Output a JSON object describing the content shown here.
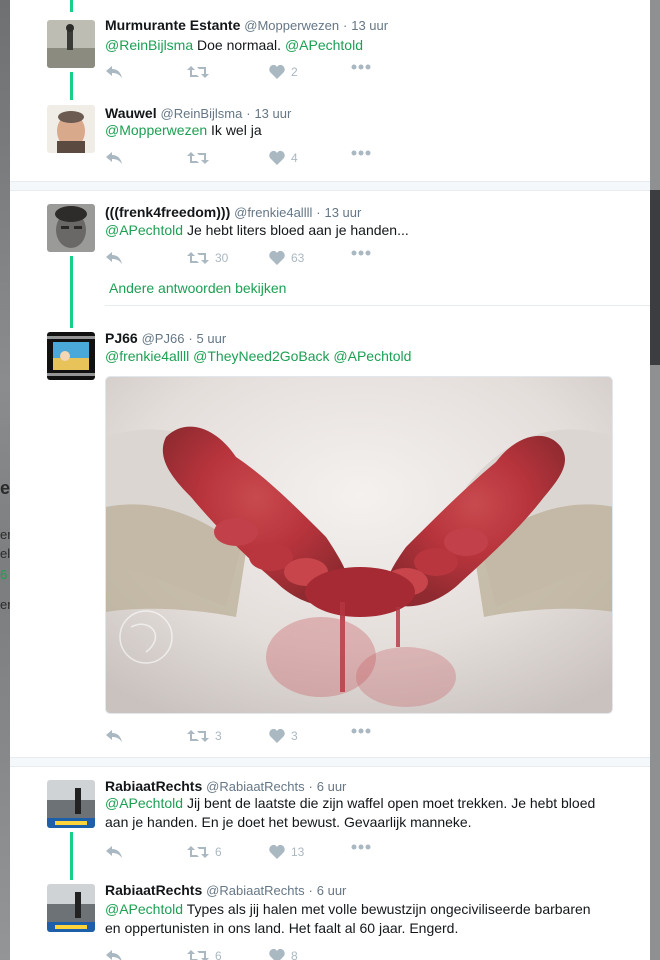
{
  "background": {
    "left_fragments": [
      "er",
      "er",
      "el",
      "6",
      "erc"
    ]
  },
  "tweets": [
    {
      "name": "Murmurante Estante",
      "handle": "@Mopperwezen",
      "time": "13 uur",
      "mention": "@ReinBijlsma",
      "text": "Doe normaal.",
      "mention2": "@APechtold",
      "retweets": "",
      "likes": "2"
    },
    {
      "name": "Wauwel",
      "handle": "@ReinBijlsma",
      "time": "13 uur",
      "mention": "@Mopperwezen",
      "text": "Ik wel ja",
      "retweets": "",
      "likes": "4"
    },
    {
      "name": "(((frenk4freedom)))",
      "handle": "@frenkie4allll",
      "time": "13 uur",
      "mention": "@APechtold",
      "text": "Je hebt liters bloed aan je handen...",
      "retweets": "30",
      "likes": "63",
      "more_replies": "Andere antwoorden bekijken"
    },
    {
      "name": "PJ66",
      "handle": "@PJ66",
      "time": "5 uur",
      "mention": "@frenkie4allll",
      "mention2": "@TheyNeed2GoBack",
      "mention3": "@APechtold",
      "retweets": "3",
      "likes": "3"
    },
    {
      "name": "RabiaatRechts",
      "handle": "@RabiaatRechts",
      "time": "6 uur",
      "mention": "@APechtold",
      "text_line1": "Jij bent de laatste die zijn waffel open moet trekken. Je hebt bloed",
      "text_line2": "aan je handen. En je doet het bewust. Gevaarlijk manneke.",
      "retweets": "6",
      "likes": "13"
    },
    {
      "name": "RabiaatRechts",
      "handle": "@RabiaatRechts",
      "time": "6 uur",
      "mention": "@APechtold",
      "text_line1": "Types als jij halen met volle bewustzijn ongeciviliseerde barbaren",
      "text_line2": "en oppertunisten in ons land. Het faalt al 60 jaar. Engerd.",
      "retweets": "6",
      "likes": "8"
    }
  ],
  "icons": {
    "reply": "reply-icon",
    "retweet": "retweet-icon",
    "like": "heart-icon",
    "more": "more-icon"
  },
  "colors": {
    "accent": "#1ca053",
    "thread_line": "#19cf86",
    "muted": "#657786",
    "icon": "#aab8c2"
  }
}
